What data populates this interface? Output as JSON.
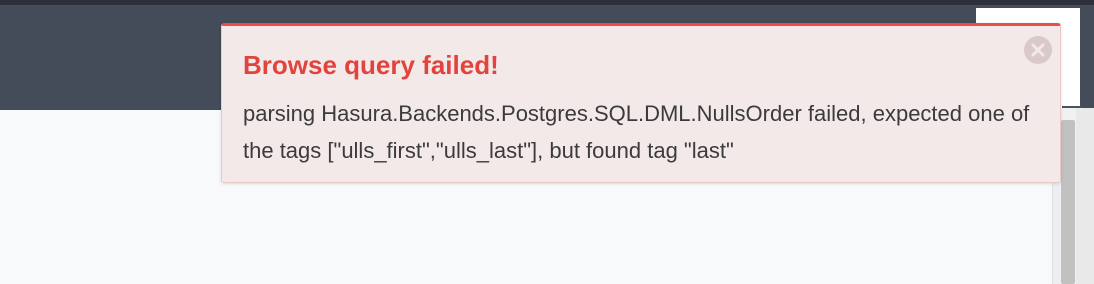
{
  "notification": {
    "title": "Browse query failed!",
    "message": "parsing Hasura.Backends.Postgres.SQL.DML.NullsOrder failed, expected one of the tags [\"ulls_first\",\"ulls_last\"], but found tag \"last\"",
    "close_icon": "close-circle-icon",
    "colors": {
      "title": "#e0443d",
      "accent_border": "#ec4d4d",
      "background": "#f4e9e9"
    }
  },
  "header": {
    "background_color": "#444b59"
  }
}
